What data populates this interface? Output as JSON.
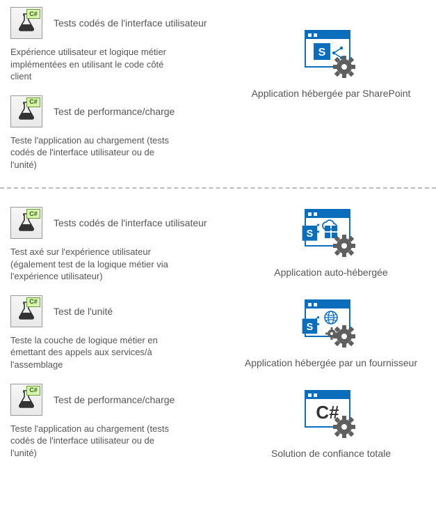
{
  "icons": {
    "csharp_badge": "C#"
  },
  "section_top": {
    "tests": [
      {
        "title": "Tests codés de l'interface utilisateur",
        "desc": "Expérience utilisateur et logique métier implémentées en utilisant le code côté client"
      },
      {
        "title": "Test de performance/charge",
        "desc": "Teste l'application au chargement (tests codés de l'interface utilisateur ou de l'unité)"
      }
    ],
    "apps": [
      {
        "label": "Application hébergée par SharePoint"
      }
    ]
  },
  "section_bottom": {
    "tests": [
      {
        "title": "Tests codés de l'interface utilisateur",
        "desc": "Test axé sur l'expérience utilisateur (également test de la logique métier via l'expérience utilisateur)"
      },
      {
        "title": "Test de l'unité",
        "desc": "Teste la couche de logique métier en émettant des appels aux services/à l'assemblage"
      },
      {
        "title": "Test de performance/charge",
        "desc": "Teste l'application au chargement (tests codés de l'interface utilisateur ou de l'unité)"
      }
    ],
    "apps": [
      {
        "label": "Application auto-hébergée"
      },
      {
        "label": "Application hébergée par un fournisseur"
      },
      {
        "label": "Solution de confiance totale"
      }
    ]
  }
}
